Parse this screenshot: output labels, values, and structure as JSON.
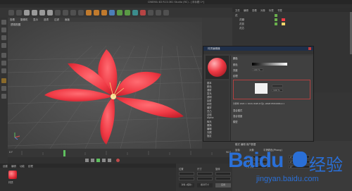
{
  "window": {
    "title": "CINEMA 4D R13.061 Studio (RC) - [未标题 1*]"
  },
  "viewport": {
    "menu": [
      "查看",
      "摄像机",
      "显示",
      "选项",
      "过滤",
      "面板"
    ],
    "label": "透视视图"
  },
  "object_manager": {
    "tabs": [
      "文件",
      "编辑",
      "查看",
      "对象",
      "标签",
      "书签"
    ],
    "rows": [
      "花",
      "花瓣",
      "花蕊",
      "花芯"
    ]
  },
  "material_dialog": {
    "title": "材质编辑器",
    "channels": [
      "基本",
      "颜色",
      "漫射",
      "发光",
      "透明",
      "反射",
      "环境",
      "烟雾",
      "凹凸",
      "法线",
      "Alpha",
      "辉光",
      "置换",
      "编辑",
      "光照",
      "指定"
    ],
    "main_header": "颜色",
    "rows": [
      "颜色",
      "亮度",
      "纹理",
      "混合模式",
      "混合强度",
      "模型"
    ],
    "brightness_value": "100 %",
    "mix_value": "100 %",
    "sample_line": "分辨率 1024 × 1024, RGB (8 位), sRGB IEC61966-2.1"
  },
  "attribute_manager": {
    "header": "模式  编辑  用户数据",
    "rows": [
      "坐标",
      "对象",
      "平滑着色(Phong)"
    ],
    "fields": [
      "0 cm",
      "0 cm",
      "0 cm",
      "0°",
      "0°",
      "0°"
    ]
  },
  "timeline": {
    "frame_label": "0 F",
    "end_label": "90 F"
  },
  "material_manager": {
    "tabs": [
      "创建",
      "编辑",
      "功能",
      "纹理"
    ],
    "material_name": "材质"
  },
  "coord_manager": {
    "labels": [
      "位置",
      "尺寸",
      "旋转"
    ],
    "buttons": [
      "对象 (相对)",
      "绝对尺寸",
      "应用"
    ]
  },
  "watermark": {
    "brand": "Baidu",
    "brand_cn": "经验",
    "url": "jingyan.baidu.com"
  },
  "colors": {
    "flower": "#f03a45",
    "accent": "#3a6fb0",
    "watermark": "#2a6fd6"
  }
}
